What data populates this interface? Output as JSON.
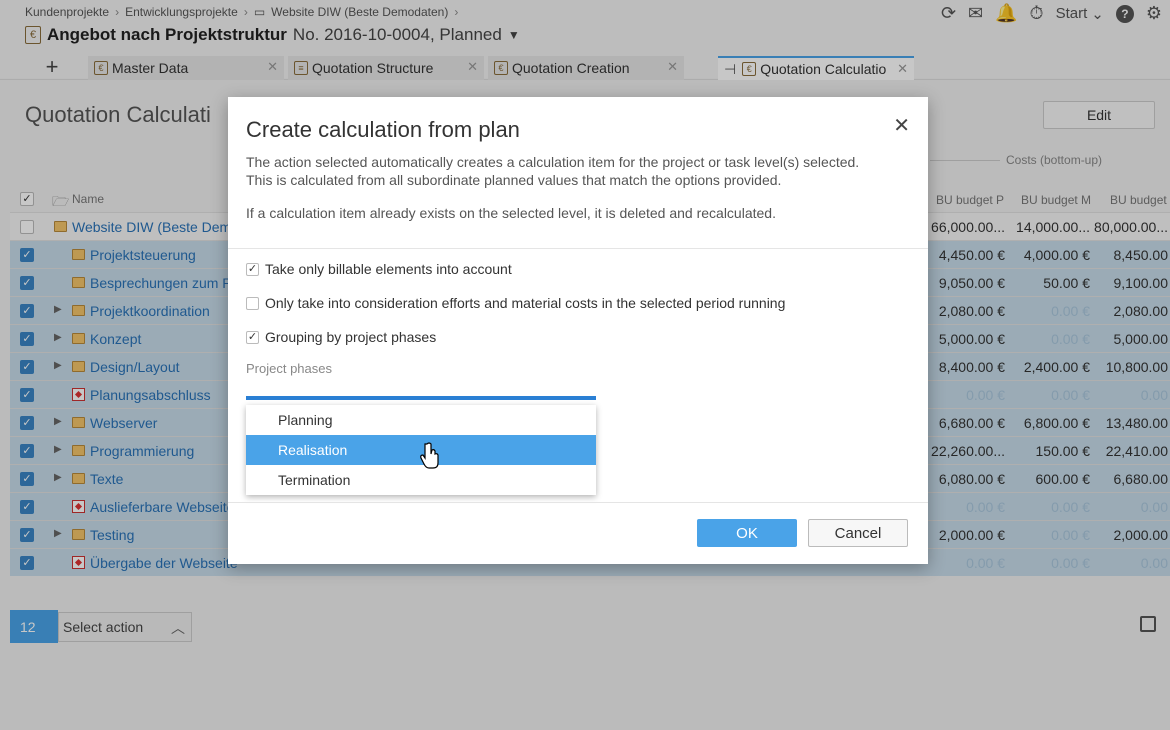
{
  "breadcrumb": [
    "Kundenprojekte",
    "Entwicklungsprojekte",
    "Website DIW (Beste Demodaten)"
  ],
  "header": {
    "title": "Angebot nach Projektstruktur",
    "subtitle": "No. 2016-10-0004, Planned",
    "start_label": "Start"
  },
  "tabs": [
    {
      "label": "Master Data"
    },
    {
      "label": "Quotation Structure"
    },
    {
      "label": "Quotation Creation"
    },
    {
      "label": "Quotation Calculatio"
    }
  ],
  "page": {
    "title": "Quotation Calculati",
    "edit_label": "Edit",
    "costs_label": "Costs (bottom-up)"
  },
  "grid": {
    "name_header": "Name",
    "col_headers": [
      "BU budget P",
      "BU budget M",
      "BU budget"
    ],
    "rows": [
      {
        "name": "Website DIW (Beste Dem",
        "c1": "66,000.00...",
        "c2": "14,000.00...",
        "c3": "80,000.00..."
      },
      {
        "name": "Projektsteuerung",
        "c1": "4,450.00 €",
        "c2": "4,000.00 €",
        "c3": "8,450.00"
      },
      {
        "name": "Besprechungen zum P",
        "c1": "9,050.00 €",
        "c2": "50.00 €",
        "c3": "9,100.00"
      },
      {
        "name": "Projektkoordination",
        "c1": "2,080.00 €",
        "c2": "0.00 €",
        "c3": "2,080.00"
      },
      {
        "name": "Konzept",
        "c1": "5,000.00 €",
        "c2": "0.00 €",
        "c3": "5,000.00"
      },
      {
        "name": "Design/Layout",
        "c1": "8,400.00 €",
        "c2": "2,400.00 €",
        "c3": "10,800.00"
      },
      {
        "name": "Planungsabschluss",
        "c1": "0.00 €",
        "c2": "0.00 €",
        "c3": "0.00"
      },
      {
        "name": "Webserver",
        "c1": "6,680.00 €",
        "c2": "6,800.00 €",
        "c3": "13,480.00"
      },
      {
        "name": "Programmierung",
        "c1": "22,260.00...",
        "c2": "150.00 €",
        "c3": "22,410.00"
      },
      {
        "name": "Texte",
        "c1": "6,080.00 €",
        "c2": "600.00 €",
        "c3": "6,680.00"
      },
      {
        "name": "Auslieferbare Webseite",
        "c1": "0.00 €",
        "c2": "0.00 €",
        "c3": "0.00"
      },
      {
        "name": "Testing",
        "c1": "2,000.00 €",
        "c2": "0.00 €",
        "c3": "2,000.00"
      },
      {
        "name": "Übergabe der Webseite",
        "c1": "0.00 €",
        "c2": "0.00 €",
        "c3": "0.00"
      }
    ]
  },
  "selection": {
    "count": "12",
    "action_label": "Select action"
  },
  "dialog": {
    "title": "Create calculation from plan",
    "desc_line1": "The action selected automatically creates a calculation item for the project or task level(s) selected.",
    "desc_line2": "This is calculated from all subordinate planned values that match the options provided.",
    "desc_line3": "If a calculation item already exists on the selected level, it is deleted and recalculated.",
    "options": [
      {
        "label": "Take only billable elements into account",
        "checked": true
      },
      {
        "label": "Only take into consideration efforts and material costs in the selected period running",
        "checked": false
      },
      {
        "label": "Grouping by project phases",
        "checked": true
      }
    ],
    "phases_label": "Project phases",
    "phases": [
      "Planning",
      "Realisation",
      "Termination"
    ],
    "highlighted_phase": "Realisation",
    "ok_label": "OK",
    "cancel_label": "Cancel"
  }
}
